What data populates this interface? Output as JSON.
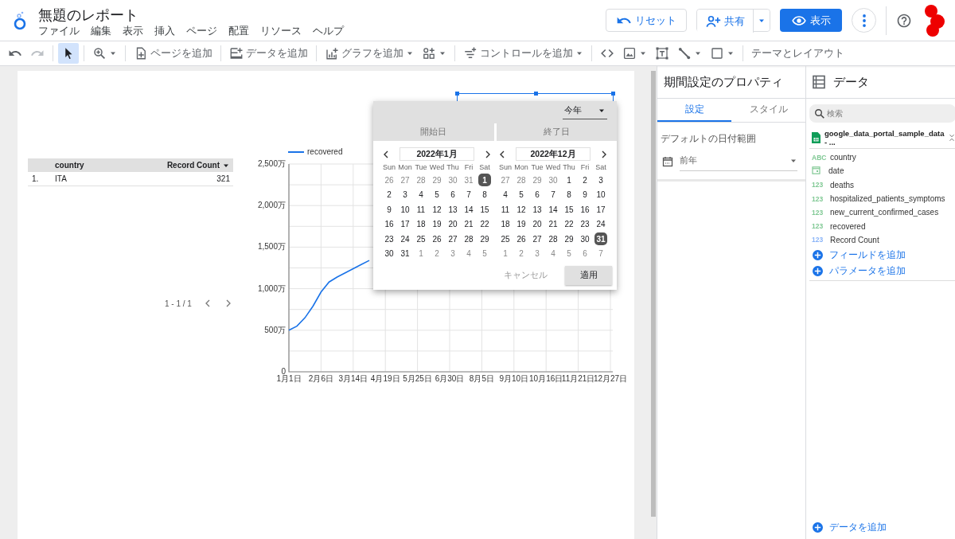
{
  "header": {
    "title": "無題のレポート",
    "menus": [
      "ファイル",
      "編集",
      "表示",
      "挿入",
      "ページ",
      "配置",
      "リソース",
      "ヘルプ"
    ],
    "reset": "リセット",
    "share": "共有",
    "view": "表示"
  },
  "toolbar": [
    {
      "kind": "undo",
      "caret": false,
      "disabled": false,
      "selected": false
    },
    {
      "kind": "redo",
      "caret": false,
      "disabled": true,
      "selected": false
    },
    {
      "kind": "sep"
    },
    {
      "kind": "select",
      "caret": false,
      "disabled": false,
      "selected": true
    },
    {
      "kind": "sep"
    },
    {
      "kind": "zoom",
      "caret": true,
      "disabled": false,
      "selected": false
    },
    {
      "kind": "sep"
    },
    {
      "kind": "page",
      "label": "ページを追加",
      "caret": false,
      "disabled": false,
      "selected": false
    },
    {
      "kind": "sep"
    },
    {
      "kind": "data",
      "label": "データを追加",
      "caret": false,
      "disabled": false,
      "selected": false
    },
    {
      "kind": "sep"
    },
    {
      "kind": "chart",
      "label": "グラフを追加",
      "caret": true,
      "disabled": false,
      "selected": false
    },
    {
      "kind": "community",
      "caret": true,
      "disabled": false,
      "selected": false
    },
    {
      "kind": "sep"
    },
    {
      "kind": "control",
      "label": "コントロールを追加",
      "caret": true,
      "disabled": false,
      "selected": false
    },
    {
      "kind": "sep"
    },
    {
      "kind": "embed",
      "caret": false,
      "disabled": false,
      "selected": false
    },
    {
      "kind": "image",
      "caret": true,
      "disabled": false,
      "selected": false
    },
    {
      "kind": "text",
      "caret": false,
      "disabled": false,
      "selected": false
    },
    {
      "kind": "line",
      "caret": true,
      "disabled": false,
      "selected": false
    },
    {
      "kind": "shape",
      "caret": true,
      "disabled": false,
      "selected": false
    },
    {
      "kind": "sep"
    },
    {
      "kind": "theme",
      "label": "テーマとレイアウト",
      "caret": false,
      "disabled": false,
      "selected": false
    }
  ],
  "canvas": {
    "table": {
      "columns": [
        "",
        "country",
        "Record Count"
      ],
      "rows": [
        [
          "1.",
          "ITA",
          "321"
        ]
      ],
      "pagination": "1 - 1 / 1"
    },
    "chart": {
      "chart_data": {
        "type": "line",
        "grid": true,
        "categories": [
          "1月1日",
          null,
          null,
          null,
          "2月6日",
          null,
          null,
          null,
          "3月14日",
          null,
          null,
          null,
          "4月19日",
          null,
          null,
          null,
          "5月25日",
          null,
          null,
          null,
          "6月30日",
          null,
          null,
          null,
          "8月5日",
          null,
          null,
          null,
          "9月10日",
          null,
          null,
          null,
          "10月16日",
          null,
          null,
          null,
          "11月21日",
          null,
          null,
          null,
          "12月27日"
        ],
        "series": [
          {
            "name": "recovered",
            "color": "#1a73e8",
            "values": [
              500,
              550,
              650,
              790,
              960,
              1080,
              1140,
              1190,
              1240,
              1290,
              1340,
              null,
              null,
              null,
              null,
              null,
              null,
              null,
              null,
              null,
              null,
              null,
              null,
              null,
              null,
              null,
              null,
              null,
              null,
              null,
              null,
              null,
              null,
              null,
              null,
              null,
              null,
              null,
              null,
              null,
              null
            ]
          }
        ],
        "ylim": [
          0,
          2500
        ],
        "yticks": [
          {
            "value": 0,
            "label": "0"
          },
          {
            "value": 500,
            "label": "500万"
          },
          {
            "value": 1000,
            "label": "1,000万"
          },
          {
            "value": 1500,
            "label": "1,500万"
          },
          {
            "value": 2000,
            "label": "2,000万"
          },
          {
            "value": 2500,
            "label": "2,500万"
          }
        ]
      }
    },
    "date_picker": {
      "preset": "今年",
      "tabs": [
        "開始日",
        "終了日"
      ],
      "months": [
        {
          "title": "2022年1月",
          "weekdays": [
            "Sun",
            "Mon",
            "Tue",
            "Wed",
            "Thu",
            "Fri",
            "Sat"
          ],
          "weeks": [
            [
              {
                "label": "26",
                "muted": true,
                "selected": false
              },
              {
                "label": "27",
                "muted": true,
                "selected": false
              },
              {
                "label": "28",
                "muted": true,
                "selected": false
              },
              {
                "label": "29",
                "muted": true,
                "selected": false
              },
              {
                "label": "30",
                "muted": true,
                "selected": false
              },
              {
                "label": "31",
                "muted": true,
                "selected": false
              },
              {
                "label": "1",
                "muted": false,
                "selected": true
              }
            ],
            [
              {
                "label": "2",
                "muted": false,
                "selected": false
              },
              {
                "label": "3",
                "muted": false,
                "selected": false
              },
              {
                "label": "4",
                "muted": false,
                "selected": false
              },
              {
                "label": "5",
                "muted": false,
                "selected": false
              },
              {
                "label": "6",
                "muted": false,
                "selected": false
              },
              {
                "label": "7",
                "muted": false,
                "selected": false
              },
              {
                "label": "8",
                "muted": false,
                "selected": false
              }
            ],
            [
              {
                "label": "9",
                "muted": false,
                "selected": false
              },
              {
                "label": "10",
                "muted": false,
                "selected": false
              },
              {
                "label": "11",
                "muted": false,
                "selected": false
              },
              {
                "label": "12",
                "muted": false,
                "selected": false
              },
              {
                "label": "13",
                "muted": false,
                "selected": false
              },
              {
                "label": "14",
                "muted": false,
                "selected": false
              },
              {
                "label": "15",
                "muted": false,
                "selected": false
              }
            ],
            [
              {
                "label": "16",
                "muted": false,
                "selected": false
              },
              {
                "label": "17",
                "muted": false,
                "selected": false
              },
              {
                "label": "18",
                "muted": false,
                "selected": false
              },
              {
                "label": "19",
                "muted": false,
                "selected": false
              },
              {
                "label": "20",
                "muted": false,
                "selected": false
              },
              {
                "label": "21",
                "muted": false,
                "selected": false
              },
              {
                "label": "22",
                "muted": false,
                "selected": false
              }
            ],
            [
              {
                "label": "23",
                "muted": false,
                "selected": false
              },
              {
                "label": "24",
                "muted": false,
                "selected": false
              },
              {
                "label": "25",
                "muted": false,
                "selected": false
              },
              {
                "label": "26",
                "muted": false,
                "selected": false
              },
              {
                "label": "27",
                "muted": false,
                "selected": false
              },
              {
                "label": "28",
                "muted": false,
                "selected": false
              },
              {
                "label": "29",
                "muted": false,
                "selected": false
              }
            ],
            [
              {
                "label": "30",
                "muted": false,
                "selected": false
              },
              {
                "label": "31",
                "muted": false,
                "selected": false
              },
              {
                "label": "1",
                "muted": true,
                "selected": false
              },
              {
                "label": "2",
                "muted": true,
                "selected": false
              },
              {
                "label": "3",
                "muted": true,
                "selected": false
              },
              {
                "label": "4",
                "muted": true,
                "selected": false
              },
              {
                "label": "5",
                "muted": true,
                "selected": false
              }
            ]
          ]
        },
        {
          "title": "2022年12月",
          "weekdays": [
            "Sun",
            "Mon",
            "Tue",
            "Wed",
            "Thu",
            "Fri",
            "Sat"
          ],
          "weeks": [
            [
              {
                "label": "27",
                "muted": true,
                "selected": false
              },
              {
                "label": "28",
                "muted": true,
                "selected": false
              },
              {
                "label": "29",
                "muted": true,
                "selected": false
              },
              {
                "label": "30",
                "muted": true,
                "selected": false
              },
              {
                "label": "1",
                "muted": false,
                "selected": false
              },
              {
                "label": "2",
                "muted": false,
                "selected": false
              },
              {
                "label": "3",
                "muted": false,
                "selected": false
              }
            ],
            [
              {
                "label": "4",
                "muted": false,
                "selected": false
              },
              {
                "label": "5",
                "muted": false,
                "selected": false
              },
              {
                "label": "6",
                "muted": false,
                "selected": false
              },
              {
                "label": "7",
                "muted": false,
                "selected": false
              },
              {
                "label": "8",
                "muted": false,
                "selected": false
              },
              {
                "label": "9",
                "muted": false,
                "selected": false
              },
              {
                "label": "10",
                "muted": false,
                "selected": false
              }
            ],
            [
              {
                "label": "11",
                "muted": false,
                "selected": false
              },
              {
                "label": "12",
                "muted": false,
                "selected": false
              },
              {
                "label": "13",
                "muted": false,
                "selected": false
              },
              {
                "label": "14",
                "muted": false,
                "selected": false
              },
              {
                "label": "15",
                "muted": false,
                "selected": false
              },
              {
                "label": "16",
                "muted": false,
                "selected": false
              },
              {
                "label": "17",
                "muted": false,
                "selected": false
              }
            ],
            [
              {
                "label": "18",
                "muted": false,
                "selected": false
              },
              {
                "label": "19",
                "muted": false,
                "selected": false
              },
              {
                "label": "20",
                "muted": false,
                "selected": false
              },
              {
                "label": "21",
                "muted": false,
                "selected": false
              },
              {
                "label": "22",
                "muted": false,
                "selected": false
              },
              {
                "label": "23",
                "muted": false,
                "selected": false
              },
              {
                "label": "24",
                "muted": false,
                "selected": false
              }
            ],
            [
              {
                "label": "25",
                "muted": false,
                "selected": false
              },
              {
                "label": "26",
                "muted": false,
                "selected": false
              },
              {
                "label": "27",
                "muted": false,
                "selected": false
              },
              {
                "label": "28",
                "muted": false,
                "selected": false
              },
              {
                "label": "29",
                "muted": false,
                "selected": false
              },
              {
                "label": "30",
                "muted": false,
                "selected": false
              },
              {
                "label": "31",
                "muted": false,
                "selected": true
              }
            ],
            [
              {
                "label": "1",
                "muted": true,
                "selected": false
              },
              {
                "label": "2",
                "muted": true,
                "selected": false
              },
              {
                "label": "3",
                "muted": true,
                "selected": false
              },
              {
                "label": "4",
                "muted": true,
                "selected": false
              },
              {
                "label": "5",
                "muted": true,
                "selected": false
              },
              {
                "label": "6",
                "muted": true,
                "selected": false
              },
              {
                "label": "7",
                "muted": true,
                "selected": false
              }
            ]
          ]
        }
      ],
      "cancel": "キャンセル",
      "apply": "適用"
    }
  },
  "properties": {
    "title": "期間設定のプロパティ",
    "tabs": [
      {
        "label": "設定",
        "selected": true
      },
      {
        "label": "スタイル",
        "selected": false
      }
    ],
    "section_label": "デフォルトの日付範囲",
    "date_range": "前年"
  },
  "data_panel": {
    "title": "データ",
    "search": {
      "placeholder": "検索"
    },
    "source": "google_data_portal_sample_data - ...",
    "fields": [
      {
        "kind": "text",
        "badge": "ABC",
        "name": "country"
      },
      {
        "kind": "date",
        "name": "date"
      },
      {
        "kind": "number",
        "badge": "123",
        "name": "deaths"
      },
      {
        "kind": "number",
        "badge": "123",
        "name": "hospitalized_patients_symptoms"
      },
      {
        "kind": "number",
        "badge": "123",
        "name": "new_current_confirmed_cases"
      },
      {
        "kind": "number",
        "badge": "123",
        "name": "recovered"
      },
      {
        "kind": "metric",
        "badge": "123",
        "name": "Record Count"
      }
    ],
    "actions": [
      "フィールドを追加",
      "パラメータを追加"
    ],
    "add_data": "データを追加"
  }
}
